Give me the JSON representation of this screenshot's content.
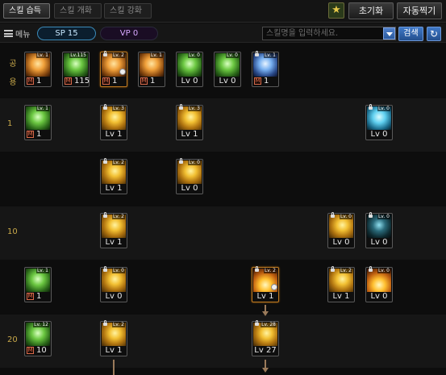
{
  "tabs": [
    {
      "label": "스킬 습득",
      "active": true
    },
    {
      "label": "스킬 개화",
      "active": false
    },
    {
      "label": "스킬 강화",
      "active": false
    }
  ],
  "header_buttons": {
    "reset": "초기화",
    "auto": "자동찍기"
  },
  "toolbar": {
    "menu_label": "메뉴",
    "sp": "SP 15",
    "vp": "VP 0",
    "search_placeholder": "스킬명을 입력하세요.",
    "search_button": "검색"
  },
  "rows": {
    "shared": "공용",
    "r1": "1",
    "r10": "10",
    "r20": "20"
  },
  "skills": {
    "s_shared_1": {
      "lv": "Lv. 1",
      "value": "1"
    },
    "s_shared_2": {
      "lv": "Lv.115",
      "value": "115"
    },
    "s_shared_3": {
      "lv": "Lv. 2",
      "value": "1"
    },
    "s_shared_4": {
      "lv": "Lv. 1",
      "value": "1"
    },
    "s_shared_5": {
      "lv": "Lv. 0",
      "value": "Lv 0"
    },
    "s_shared_6": {
      "lv": "Lv. 0",
      "value": "Lv 0"
    },
    "s_shared_7": {
      "lv": "Lv. 1",
      "value": "1"
    },
    "s_r1_1": {
      "lv": "Lv. 1",
      "value": "1"
    },
    "s_r1_2": {
      "lv": "Lv. 3",
      "value": "Lv 1"
    },
    "s_r1_3": {
      "lv": "Lv. 3",
      "value": "Lv 1"
    },
    "s_r1_4": {
      "lv": "Lv. 0",
      "value": "Lv 0"
    },
    "s_r2_1": {
      "lv": "Lv. 2",
      "value": "Lv 1"
    },
    "s_r2_2": {
      "lv": "Lv. 0",
      "value": "Lv 0"
    },
    "s_r10_1": {
      "lv": "Lv. 2",
      "value": "Lv 1"
    },
    "s_r10_2": {
      "lv": "Lv. 0",
      "value": "Lv 0"
    },
    "s_r10_3": {
      "lv": "Lv. 0",
      "value": "Lv 0"
    },
    "s_r4_1": {
      "lv": "Lv. 1",
      "value": "1"
    },
    "s_r4_2": {
      "lv": "Lv. 0",
      "value": "Lv 0"
    },
    "s_r4_3": {
      "lv": "Lv. 2",
      "value": "Lv 1"
    },
    "s_r4_4": {
      "lv": "Lv. 2",
      "value": "Lv 1"
    },
    "s_r4_5": {
      "lv": "Lv. 0",
      "value": "Lv 0"
    },
    "s_r20_1": {
      "lv": "Lv. 12",
      "value": "10"
    },
    "s_r20_2": {
      "lv": "Lv. 2",
      "value": "Lv 1"
    },
    "s_r20_3": {
      "lv": "Lv. 28",
      "value": "Lv 27"
    }
  }
}
